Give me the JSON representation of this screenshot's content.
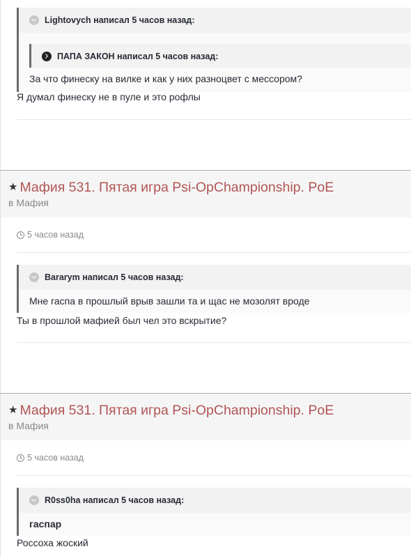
{
  "posts": [
    {
      "quote": {
        "author_line": "Lightovych написал 5 часов назад:",
        "nested": {
          "author_line": "ПАПА ЗАКОН написал 5 часов назад:",
          "text": "За что финеску на вилке и как у них разноцвет с мессором?"
        }
      },
      "reply": "Я думал финеску не в пуле и это рофлы"
    },
    {
      "title": "Мафия 531. Пятая игра Psi-OpChampionship. PoE",
      "category_prefix": "в ",
      "category": "Мафия",
      "time": "5 часов назад",
      "quote": {
        "author_line": "Bararym написал 5 часов назад:",
        "text": "Мне гаспа в прошлый врыв зашли та и щас не мозолят вроде"
      },
      "reply": "Ты в прошлой мафией был чел это вскрытие?"
    },
    {
      "title": "Мафия 531. Пятая игра Psi-OpChampionship. PoE",
      "category_prefix": "в ",
      "category": "Мафия",
      "time": "5 часов назад",
      "quote": {
        "author_line": "R0ss0ha написал 5 часов назад:",
        "text": "гаспар"
      },
      "reply": "Россоха жоский"
    }
  ],
  "icons": {
    "star": "star-icon",
    "clock": "clock-icon",
    "quote_toggle": "chevron-circle-icon",
    "quote_jump": "arrow-circle-icon"
  }
}
